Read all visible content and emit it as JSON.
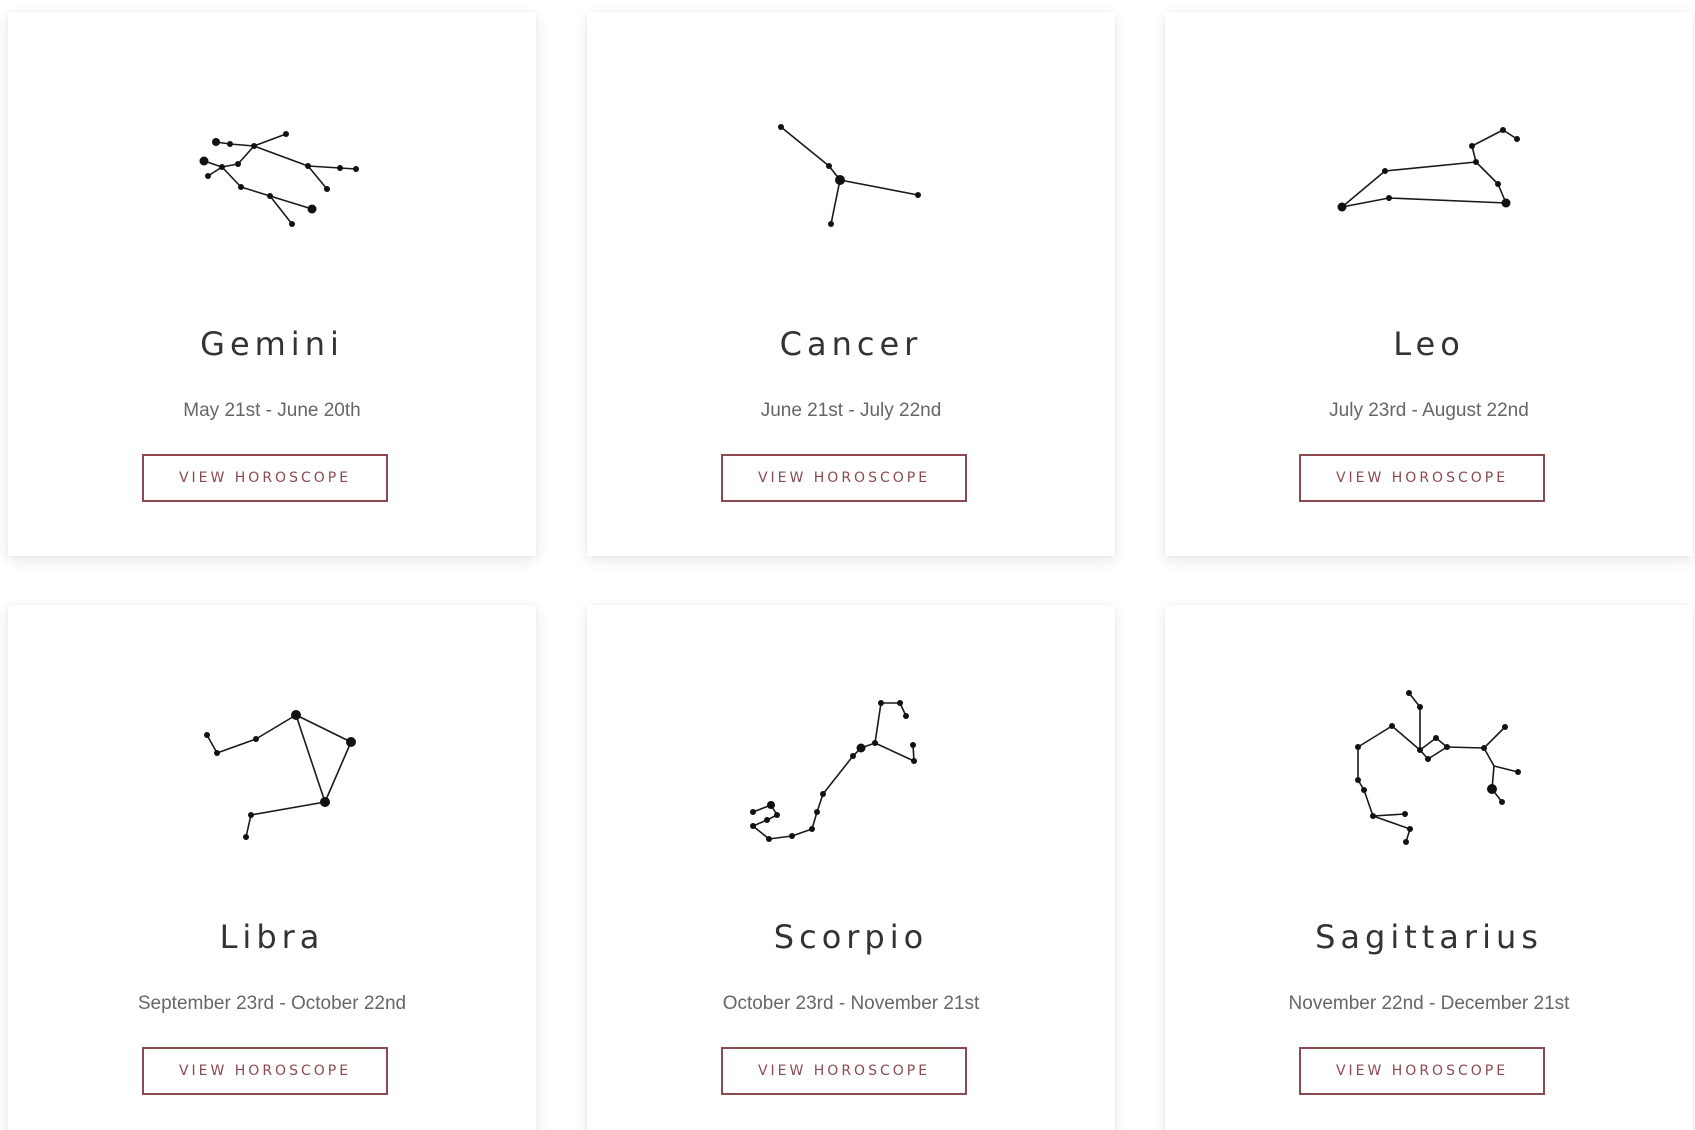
{
  "signs": [
    {
      "name": "Gemini",
      "dates": "May 21st - June 20th",
      "button": "VIEW HOROSCOPE",
      "icon": "gemini-constellation-icon"
    },
    {
      "name": "Cancer",
      "dates": "June 21st - July 22nd",
      "button": "VIEW HOROSCOPE",
      "icon": "cancer-constellation-icon"
    },
    {
      "name": "Leo",
      "dates": "July 23rd - August 22nd",
      "button": "VIEW HOROSCOPE",
      "icon": "leo-constellation-icon"
    },
    {
      "name": "Libra",
      "dates": "September 23rd - October 22nd",
      "button": "VIEW HOROSCOPE",
      "icon": "libra-constellation-icon"
    },
    {
      "name": "Scorpio",
      "dates": "October 23rd - November 21st",
      "button": "VIEW HOROSCOPE",
      "icon": "scorpio-constellation-icon"
    },
    {
      "name": "Sagittarius",
      "dates": "November 22nd - December 21st",
      "button": "VIEW HOROSCOPE",
      "icon": "sagittarius-constellation-icon"
    }
  ],
  "colors": {
    "accent": "#8b4a4f",
    "heading": "#333333",
    "dates": "#666666",
    "background": "#ffffff"
  }
}
